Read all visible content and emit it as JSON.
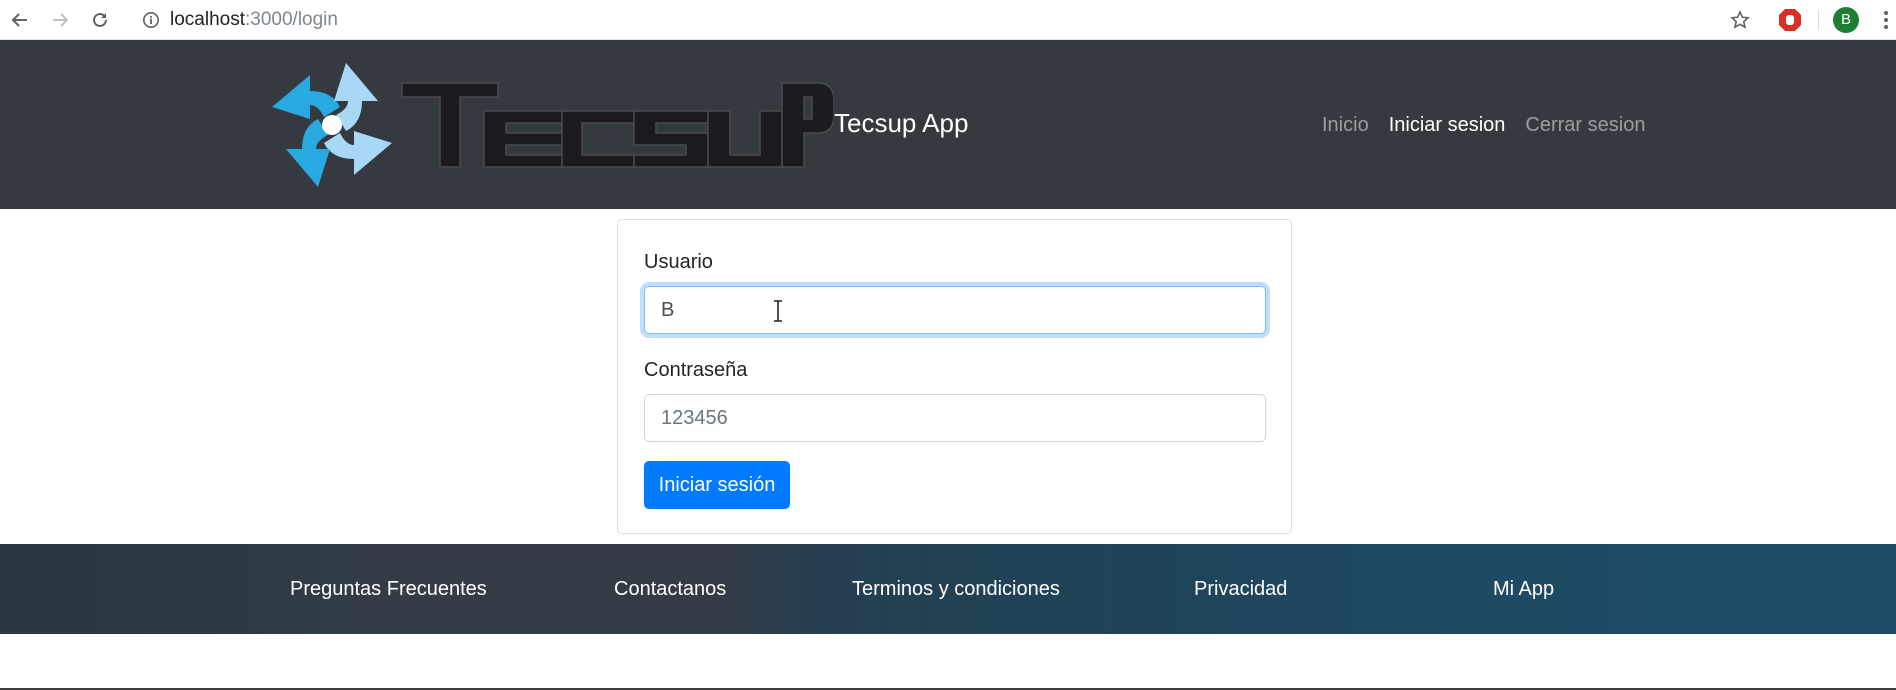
{
  "browser": {
    "url_host": "localhost",
    "url_path": ":3000/login",
    "profile_initial": "B"
  },
  "header": {
    "brand": "Tecsup App",
    "logo_alt": "TECSUP",
    "nav": [
      {
        "label": "Inicio",
        "active": false
      },
      {
        "label": "Iniciar sesion",
        "active": true
      },
      {
        "label": "Cerrar sesion",
        "active": false
      }
    ]
  },
  "login": {
    "user_label": "Usuario",
    "user_value": "B",
    "password_label": "Contraseña",
    "password_placeholder": "123456",
    "submit_label": "Iniciar sesión"
  },
  "footer": {
    "links": [
      "Preguntas Frecuentes",
      "Contactanos",
      "Terminos y condiciones",
      "Privacidad",
      "Mi App"
    ]
  },
  "colors": {
    "header_bg": "#343a40",
    "primary": "#007bff",
    "logo_blue": "#29a9e1",
    "logo_light_blue": "#a9d8f7",
    "logo_text": "#1b1b1f",
    "profile_green": "#1e7e34",
    "block_red": "#d93025"
  }
}
